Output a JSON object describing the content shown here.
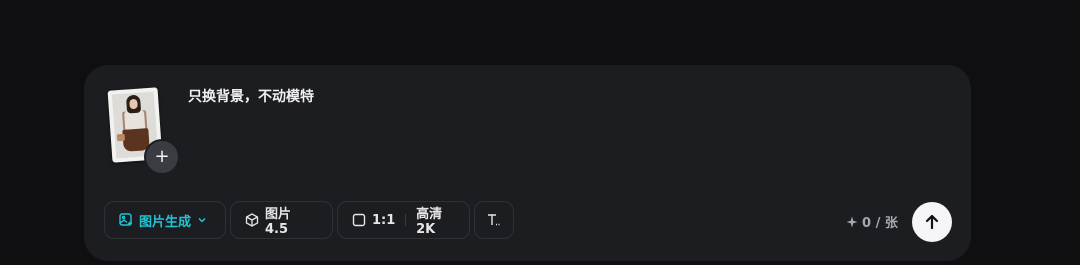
{
  "composer": {
    "prompt_text": "只换背景，不动模特",
    "attachment": {
      "add_label": "+"
    }
  },
  "toolbar": {
    "mode_label": "图片生成",
    "model_label": "图片 4.5",
    "ratio_label": "1:1",
    "quality_label": "高清 2K"
  },
  "credits": {
    "text": "0 / 张",
    "icon": "sparkle-icon"
  },
  "send": {
    "icon": "arrow-up-icon"
  },
  "colors": {
    "accent": "#22c4d4",
    "panel": "#1c1d21",
    "background": "#0f0f11"
  }
}
